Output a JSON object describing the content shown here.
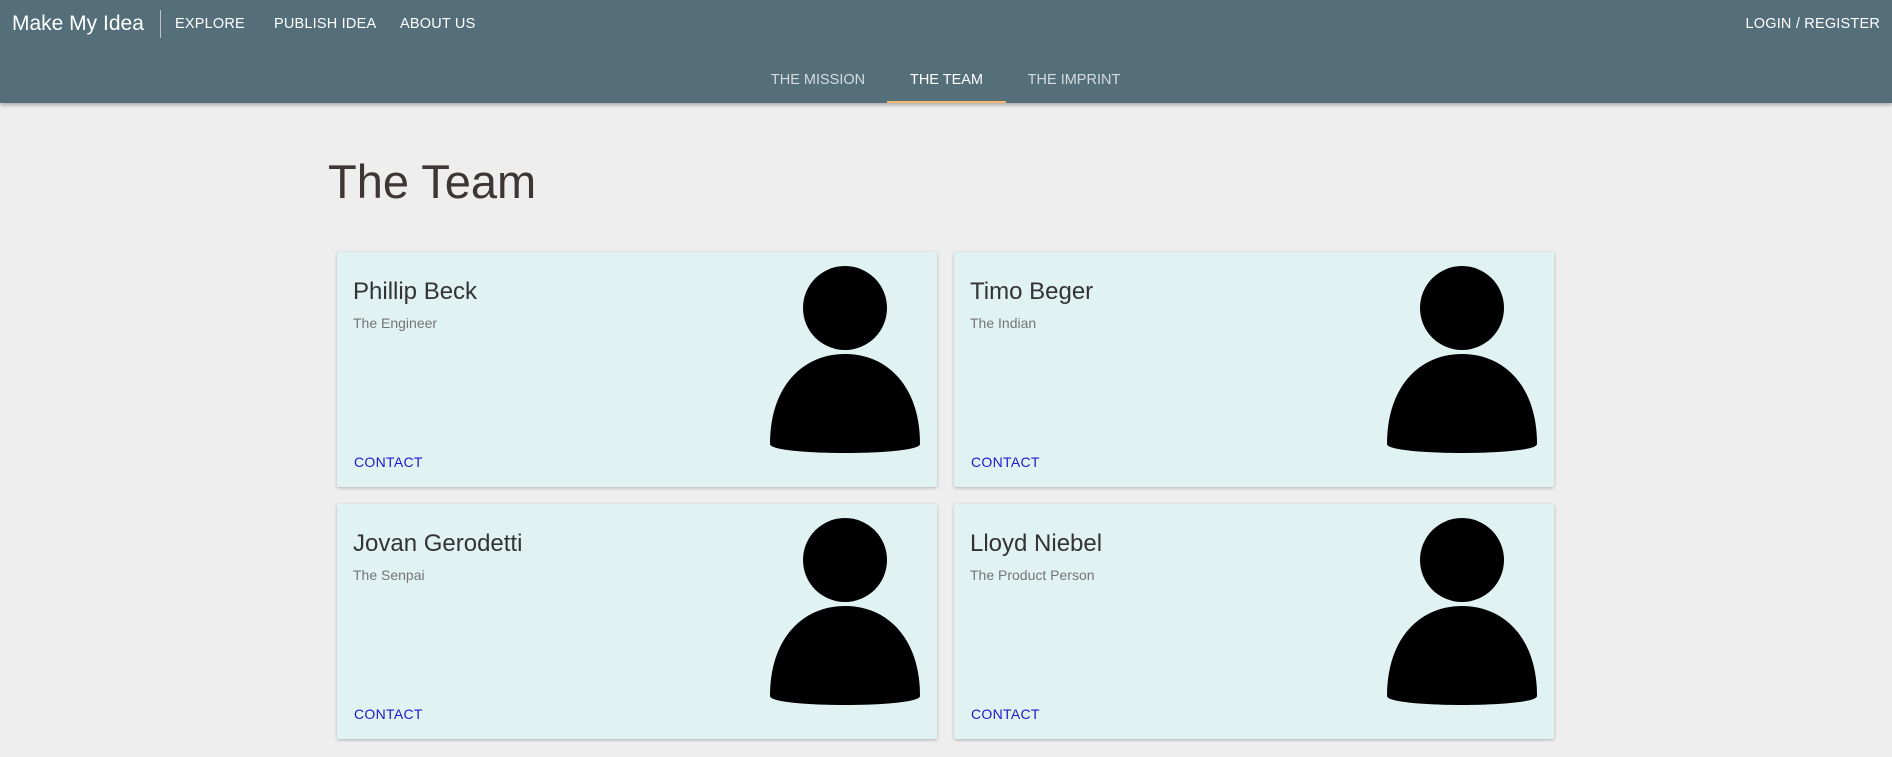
{
  "header": {
    "brand": "Make My Idea",
    "nav": [
      "EXPLORE",
      "PUBLISH IDEA",
      "ABOUT US"
    ],
    "login": "LOGIN / REGISTER"
  },
  "subnav": {
    "tabs": [
      "THE MISSION",
      "THE TEAM",
      "THE IMPRINT"
    ],
    "active": "THE TEAM"
  },
  "page": {
    "title": "The Team"
  },
  "team": [
    {
      "name": "Phillip Beck",
      "role": "The Engineer",
      "contact": "CONTACT"
    },
    {
      "name": "Timo Beger",
      "role": "The Indian",
      "contact": "CONTACT"
    },
    {
      "name": "Jovan Gerodetti",
      "role": "The Senpai",
      "contact": "CONTACT"
    },
    {
      "name": "Lloyd Niebel",
      "role": "The Product Person",
      "contact": "CONTACT"
    }
  ],
  "colors": {
    "header_bg": "#546e7a",
    "page_bg": "#eeeeee",
    "card_bg": "#e0f2f1",
    "tab_indicator": "#f5b76b",
    "contact_link": "#1a1acc"
  }
}
